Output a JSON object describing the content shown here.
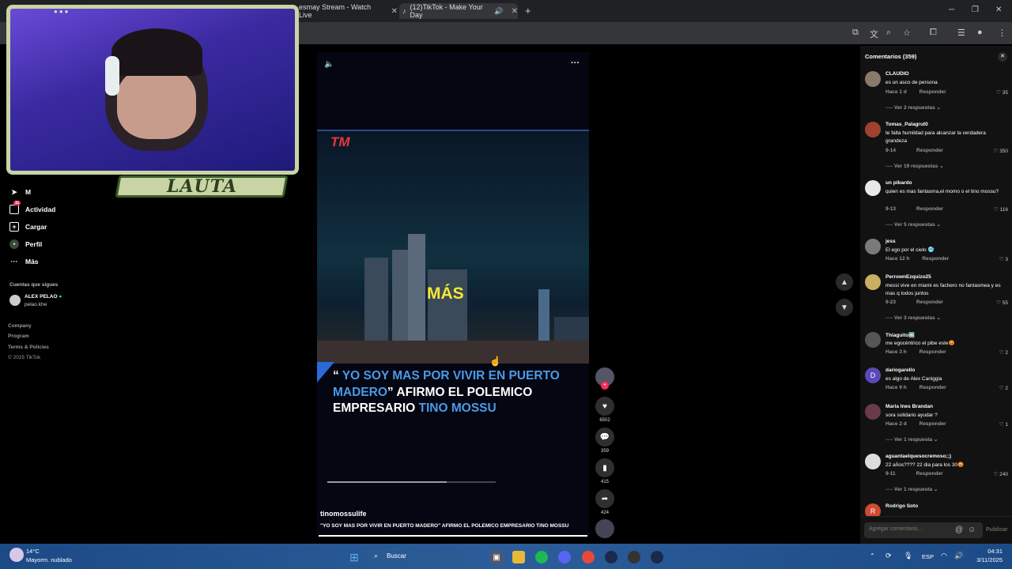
{
  "browser": {
    "tabs": [
      {
        "label": "esmay Stream - Watch Live"
      },
      {
        "label": "(12)TikTok - Make Your Day"
      }
    ],
    "new_tab_icon": "plus-icon"
  },
  "webcam": {
    "badge": "LAUTA"
  },
  "nav": {
    "items": [
      {
        "label": "M",
        "icon": "message-icon",
        "badge": ""
      },
      {
        "label": "Actividad",
        "icon": "inbox-icon",
        "badge": "11"
      },
      {
        "label": "Cargar",
        "icon": "plus-square-icon"
      },
      {
        "label": "Perfil",
        "icon": "profile-icon"
      },
      {
        "label": "Más",
        "icon": "more-icon"
      }
    ],
    "following_title": "Cuentas que sigues",
    "following": [
      {
        "name": "ALEX PELAO",
        "handle": "pelao.khe",
        "verified": true
      }
    ],
    "footer": [
      "Company",
      "Program",
      "Terms & Policies",
      "© 2025 TikTok"
    ]
  },
  "video": {
    "logo": "TM",
    "overlay_word": "MÁS",
    "headline_quote_open": "“",
    "headline_blue1": "YO SOY MAS POR VIVIR EN PUERTO MADERO",
    "headline_quote_close": "”",
    "headline_white": " AFIRMO EL POLEMICO EMPRESARIO ",
    "headline_blue2": "TINO MOSSU",
    "author": "tinomossulife",
    "caption": "\"YO SOY MAS POR VIVIR EN PUERTO MADERO\" AFIRMO EL POLEMICO EMPRESARIO TINO MOSSU",
    "progress": 0.71
  },
  "actions": {
    "likes": "6502",
    "comments": "359",
    "saves": "415",
    "shares": "424"
  },
  "comments_panel": {
    "title": "Comentarios (359)",
    "reply_label": "Responder",
    "input_placeholder": "Agregar comentario...",
    "publish": "Publicar",
    "items": [
      {
        "name": "CLAUDIO",
        "text": "es un asco de persona",
        "time": "Hace 1 d",
        "likes": "35",
        "replies": "Ver 2 respuestas",
        "color": "#8a7a6a"
      },
      {
        "name": "Tomas_Palagrut0",
        "text": "te falta humildad para alcanzar la verdadera grandeza",
        "time": "9-14",
        "likes": "350",
        "replies": "Ver 19 respuestas",
        "color": "#a04030"
      },
      {
        "name": "un pibardo",
        "text": "quien es mas fantasma,el momo o el tino mossu?",
        "time": "9-13",
        "likes": "116",
        "replies": "Ver 5 respuestas",
        "color": "#e8e8e8"
      },
      {
        "name": "jess",
        "text": "El ego por el cielo 🥶",
        "time": "Hace 12 h",
        "likes": "3",
        "replies": "",
        "color": "#7a7a7a"
      },
      {
        "name": "PerrownEzquizo25",
        "text": "messi vive en miami es fachero no fantasmea y es mas q todos juntos",
        "time": "9-23",
        "likes": "55",
        "replies": "Ver 3 respuestas",
        "color": "#c8b060"
      },
      {
        "name": "Thiaguito🔤",
        "text": "me egocéntrico el pibe este😡",
        "time": "Hace 3 h",
        "likes": "2",
        "replies": "",
        "color": "#555"
      },
      {
        "name": "dariogarello",
        "text": "es algo de Alex Caniggia",
        "time": "Hace 9 h",
        "likes": "2",
        "replies": "",
        "color": "#5a4ab8"
      },
      {
        "name": "Maria Ines Brandan",
        "text": "sora solidario ayudar ?",
        "time": "Hace 2 d",
        "likes": "1",
        "replies": "Ver 1 respuesta",
        "color": "#6a3a4a"
      },
      {
        "name": "aguantaelquesocremoso;;)",
        "text": "22 años???? 22 dia para los 30😡",
        "time": "9-11",
        "likes": "240",
        "replies": "Ver 1 respuesta",
        "color": "#ddd"
      },
      {
        "name": "Rodrigo Soto",
        "text": "",
        "time": "",
        "likes": "",
        "replies": "",
        "color": "#d04a30"
      }
    ]
  },
  "taskbar": {
    "weather_temp": "14°C",
    "weather_desc": "Mayorm. nublado",
    "search_label": "Buscar",
    "lang": "ESP",
    "time": "04:31",
    "date": "3/11/2025"
  }
}
